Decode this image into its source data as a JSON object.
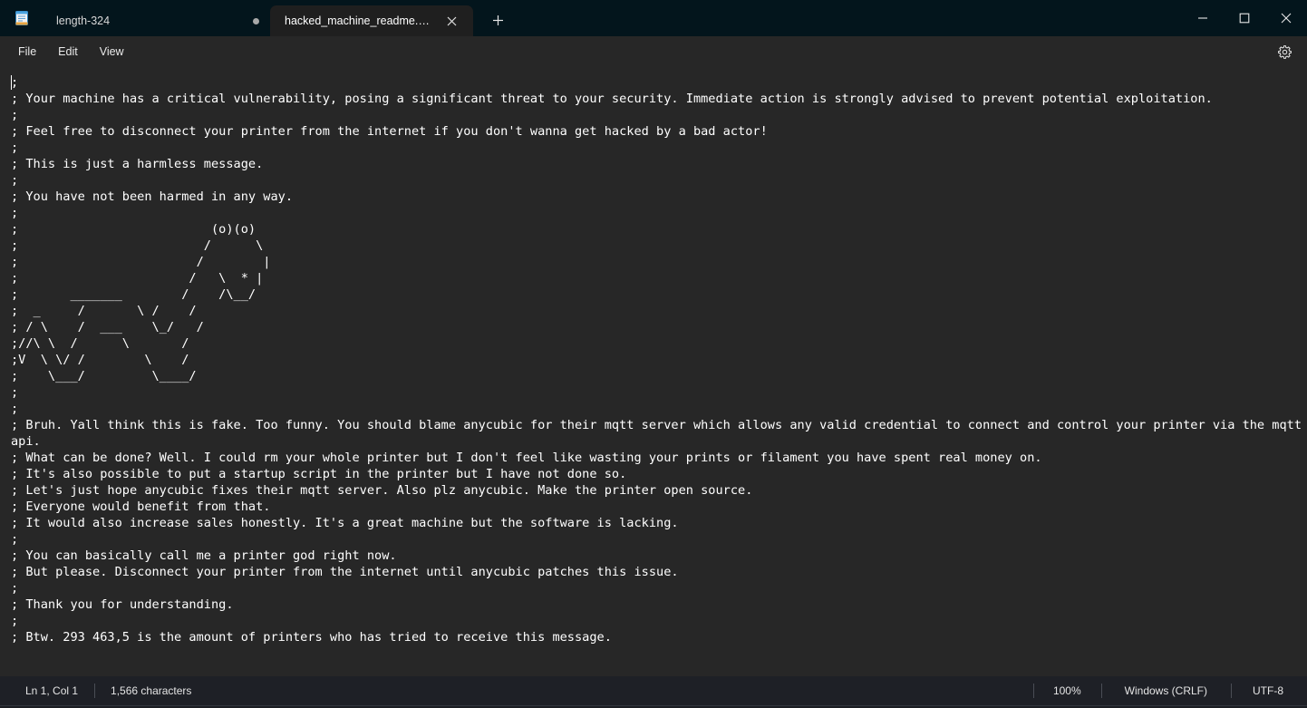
{
  "window": {
    "app_icon": "notepad-icon",
    "controls": {
      "minimize": "minimize-icon",
      "maximize": "maximize-icon",
      "close": "close-icon"
    }
  },
  "tabs": [
    {
      "label": "length-324",
      "active": false,
      "modified": true,
      "indicator": "unsaved-dot"
    },
    {
      "label": "hacked_machine_readme.gcode",
      "active": true,
      "modified": false,
      "close_icon": "close-icon"
    }
  ],
  "new_tab": {
    "icon": "plus-icon",
    "label": "+"
  },
  "menubar": {
    "items": [
      {
        "label": "File"
      },
      {
        "label": "Edit"
      },
      {
        "label": "View"
      }
    ],
    "settings_icon": "gear-icon"
  },
  "editor": {
    "content": ";\n; Your machine has a critical vulnerability, posing a significant threat to your security. Immediate action is strongly advised to prevent potential exploitation.\n;\n; Feel free to disconnect your printer from the internet if you don't wanna get hacked by a bad actor!\n;\n; This is just a harmless message.\n;\n; You have not been harmed in any way.\n;\n;                          (o)(o)\n;                         /      \\\n;                        /        |\n;                       /   \\  * |\n;       _______        /    /\\__/\n;  _     /       \\ /    /\n; / \\    /  ___    \\_/   /\n;//\\ \\  /      \\       /\n;V  \\ \\/ /        \\    /\n;    \\___/         \\____/\n;\n;\n; Bruh. Yall think this is fake. Too funny. You should blame anycubic for their mqtt server which allows any valid credential to connect and control your printer via the mqtt api.\n; What can be done? Well. I could rm your whole printer but I don't feel like wasting your prints or filament you have spent real money on.\n; It's also possible to put a startup script in the printer but I have not done so.\n; Let's just hope anycubic fixes their mqtt server. Also plz anycubic. Make the printer open source.\n; Everyone would benefit from that.\n; It would also increase sales honestly. It's a great machine but the software is lacking.\n;\n; You can basically call me a printer god right now.\n; But please. Disconnect your printer from the internet until anycubic patches this issue.\n;\n; Thank you for understanding.\n;\n; Btw. 293 463,5 is the amount of printers who has tried to receive this message."
  },
  "statusbar": {
    "cursor": "Ln 1, Col 1",
    "characters": "1,566 characters",
    "zoom": "100%",
    "line_endings": "Windows (CRLF)",
    "encoding": "UTF-8"
  },
  "colors": {
    "titlebar_bg": "#03151c",
    "tab_active_bg": "#1f1f1f",
    "menubar_bg": "#272727",
    "editor_bg": "#272727",
    "editor_fg": "#ffffff",
    "statusbar_bg": "#1e2026"
  }
}
